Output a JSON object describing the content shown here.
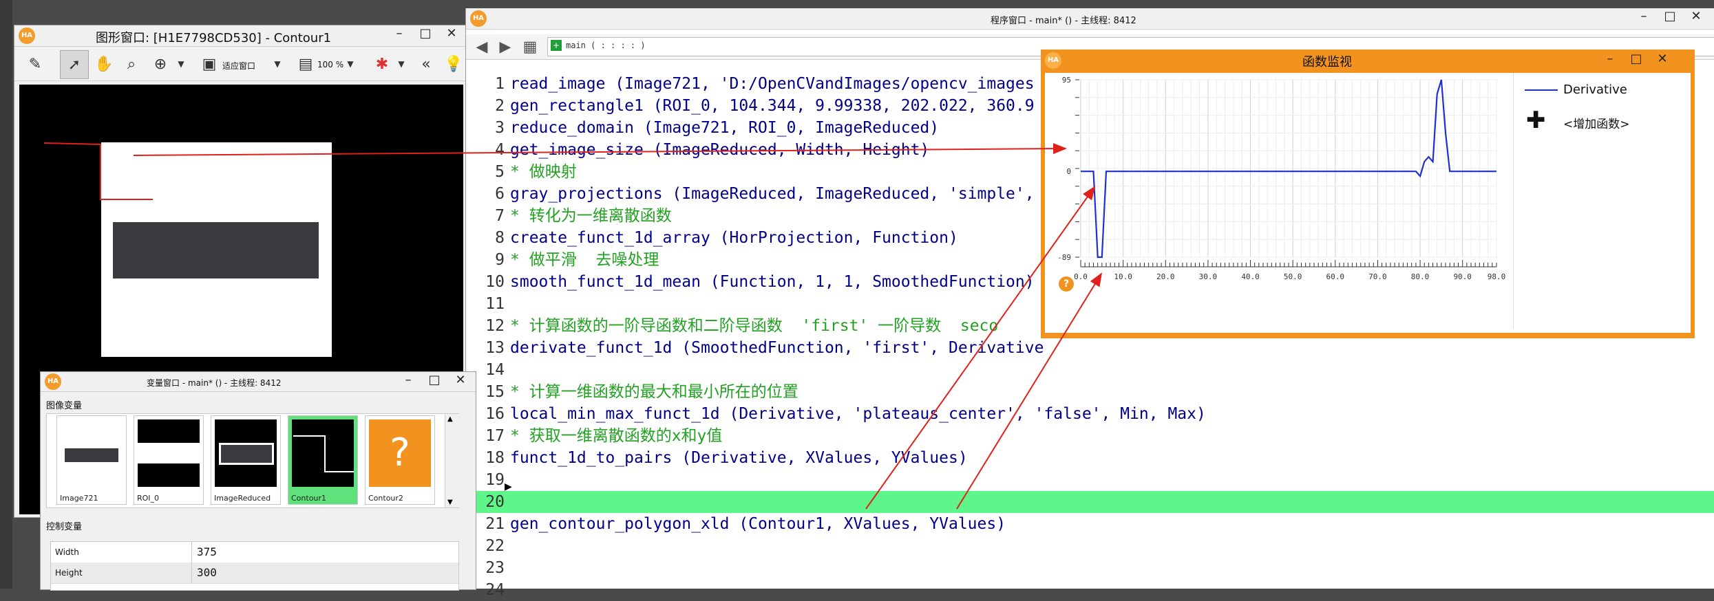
{
  "graphics_window": {
    "title": "图形窗口: [H1E7798CD530] - Contour1",
    "fit_label": "适应窗口",
    "zoom_label": "100 %"
  },
  "program_window": {
    "title": "程序窗口 - main* () - 主线程: 8412",
    "proc_label": "main ( : : : : )",
    "lines": [
      {
        "n": "1",
        "text": "read_image (Image721, 'D:/OpenCVandImages/opencv_images",
        "kind": "code"
      },
      {
        "n": "2",
        "text": "gen_rectangle1 (ROI_0, 104.344, 9.99338, 202.022, 360.9",
        "kind": "code"
      },
      {
        "n": "3",
        "text": "reduce_domain (Image721, ROI_0, ImageReduced)",
        "kind": "code"
      },
      {
        "n": "4",
        "text": "get_image_size (ImageReduced, Width, Height)",
        "kind": "code"
      },
      {
        "n": "5",
        "text": "* 做映射",
        "kind": "comment"
      },
      {
        "n": "6",
        "text": "gray_projections (ImageReduced, ImageReduced, 'simple',",
        "kind": "code"
      },
      {
        "n": "7",
        "text": "* 转化为一维离散函数",
        "kind": "comment"
      },
      {
        "n": "8",
        "text": "create_funct_1d_array (HorProjection, Function)",
        "kind": "code"
      },
      {
        "n": "9",
        "text": "* 做平滑  去噪处理",
        "kind": "comment"
      },
      {
        "n": "10",
        "text": "smooth_funct_1d_mean (Function, 1, 1, SmoothedFunction)",
        "kind": "code"
      },
      {
        "n": "11",
        "text": "",
        "kind": "code"
      },
      {
        "n": "12",
        "text": "* 计算函数的一阶导函数和二阶导函数  'first' 一阶导数  seco",
        "kind": "comment"
      },
      {
        "n": "13",
        "text": "derivate_funct_1d (SmoothedFunction, 'first', Derivative",
        "kind": "code"
      },
      {
        "n": "14",
        "text": "",
        "kind": "code"
      },
      {
        "n": "15",
        "text": "* 计算一维函数的最大和最小所在的位置",
        "kind": "comment"
      },
      {
        "n": "16",
        "text": "local_min_max_funct_1d (Derivative, 'plateaus_center', 'false', Min, Max)",
        "kind": "code"
      },
      {
        "n": "17",
        "text": "* 获取一维离散函数的x和y值",
        "kind": "comment"
      },
      {
        "n": "18",
        "text": "funct_1d_to_pairs (Derivative, XValues, YValues)",
        "kind": "code"
      },
      {
        "n": "19",
        "text": "",
        "kind": "code"
      },
      {
        "n": "20",
        "text": "",
        "kind": "current"
      },
      {
        "n": "21",
        "text": "gen_contour_polygon_xld (Contour1, XValues, YValues)",
        "kind": "code"
      },
      {
        "n": "22",
        "text": "",
        "kind": "code"
      },
      {
        "n": "23",
        "text": "",
        "kind": "code"
      },
      {
        "n": "24",
        "text": "",
        "kind": "code"
      }
    ]
  },
  "variable_window": {
    "title": "变量窗口 - main* () - 主线程: 8412",
    "image_section": "图像变量",
    "control_section": "控制变量",
    "images": [
      {
        "name": "Image721",
        "selected": false
      },
      {
        "name": "ROI_0",
        "selected": false
      },
      {
        "name": "ImageReduced",
        "selected": false
      },
      {
        "name": "Contour1",
        "selected": true
      },
      {
        "name": "Contour2",
        "selected": false
      }
    ],
    "controls": [
      {
        "name": "Width",
        "value": "375"
      },
      {
        "name": "Height",
        "value": "300"
      }
    ]
  },
  "function_monitor": {
    "title": "函数监视",
    "legend_label": "Derivative",
    "add_label": "<增加函数>",
    "help_label": "?"
  },
  "chart_data": {
    "type": "line",
    "series": [
      {
        "name": "Derivative",
        "x": [
          0,
          1,
          2,
          3,
          4,
          5,
          6,
          7,
          8,
          9,
          10,
          20,
          30,
          40,
          50,
          60,
          70,
          78,
          79,
          80,
          81,
          82,
          83,
          84,
          85,
          86,
          87,
          88,
          90,
          98
        ],
        "y": [
          0,
          0,
          0,
          0,
          -89,
          -89,
          0,
          0,
          0,
          0,
          0,
          0,
          0,
          0,
          0,
          0,
          0,
          0,
          0,
          -5,
          10,
          15,
          10,
          80,
          95,
          40,
          0,
          0,
          0,
          0
        ]
      }
    ],
    "xlim": [
      0,
      98
    ],
    "ylim": [
      -89,
      95
    ],
    "y_tick_labels": [
      "95",
      "0",
      "-89"
    ],
    "x_tick_labels": [
      "0.0",
      "10.0",
      "20.0",
      "30.0",
      "40.0",
      "50.0",
      "60.0",
      "70.0",
      "80.0",
      "90.0",
      "98.0"
    ],
    "grid": true,
    "legend": "right"
  },
  "colors": {
    "monitor_border": "#f3931f",
    "current_line": "#5ef58a",
    "selected_thumb": "#5fe27c",
    "comment": "#22a122",
    "series": "#1f2fd0",
    "arrow": "#e0201a"
  }
}
